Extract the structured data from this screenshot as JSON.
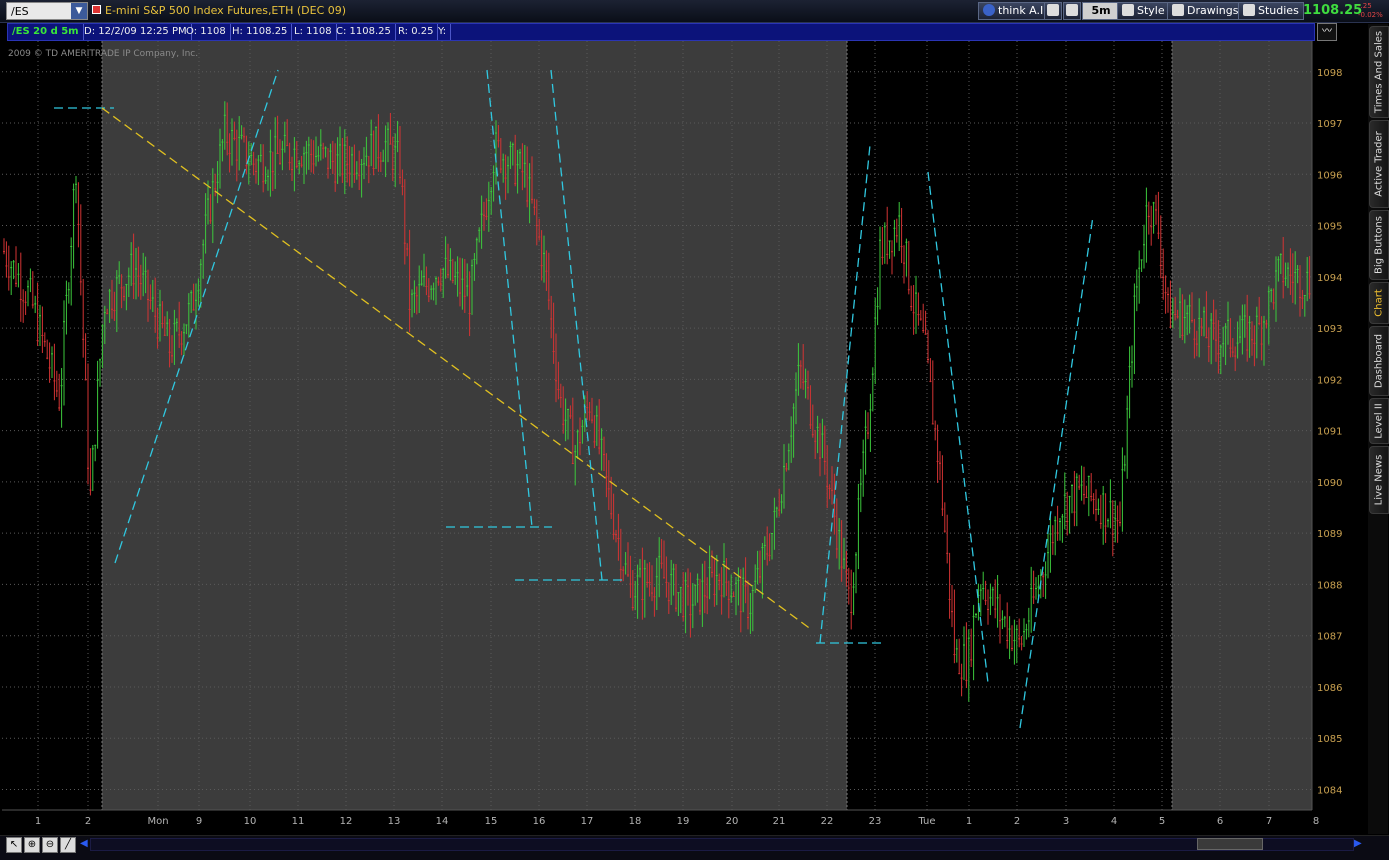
{
  "toolbar": {
    "symbol": "/ES",
    "symbol_description": "E-mini S&P 500 Index Futures,ETH (DEC 09)",
    "think_ai_label": "think A.I.",
    "interval_label": "5m",
    "style_label": "Style",
    "drawings_label": "Drawings",
    "studies_label": "Studies",
    "last_price": "1108.25",
    "net_change": "-.25",
    "pct_change": "-0.02%"
  },
  "info_bar": {
    "symbol_period": "/ES 20 d 5m",
    "date": "D: 12/2/09 12:25 PM",
    "open": "O: 1108",
    "high": "H: 1108.25",
    "low": "L: 1108",
    "close": "C: 1108.25",
    "range": "R: 0.25",
    "y": "Y:"
  },
  "copyright": "2009 © TD AMERITRADE IP Company, Inc.",
  "side_tabs": [
    "Times And Sales",
    "Active Trader",
    "Big Buttons",
    "Chart",
    "Dashboard",
    "Level II",
    "Live News"
  ],
  "active_side_tab": "Chart",
  "colors": {
    "up_bar": "#3cc83c",
    "down_bar": "#d33434",
    "trendline": "#e0c020",
    "drawing": "#30c8e0",
    "regular_session_bg": "#3c3c3c",
    "extended_session_bg": "#000000",
    "price_axis_text": "#c8a050",
    "time_axis_text": "#b4b4b4"
  },
  "chart_data": {
    "type": "candlestick",
    "ylim": [
      1083.6,
      1098.6
    ],
    "y_ticks": [
      "1098",
      "1097",
      "1096",
      "1095",
      "1094",
      "1093",
      "1092",
      "1091",
      "1090",
      "1089",
      "1088",
      "1087",
      "1086",
      "1085",
      "1084"
    ],
    "x_labels": [
      "1",
      "2",
      "Mon",
      "9",
      "10",
      "11",
      "12",
      "13",
      "14",
      "15",
      "16",
      "17",
      "18",
      "19",
      "20",
      "21",
      "22",
      "23",
      "Tue",
      "1",
      "2",
      "3",
      "4",
      "5",
      "6",
      "7",
      "8"
    ],
    "session_shading": "gray = regular trading hours, black = overnight"
  }
}
